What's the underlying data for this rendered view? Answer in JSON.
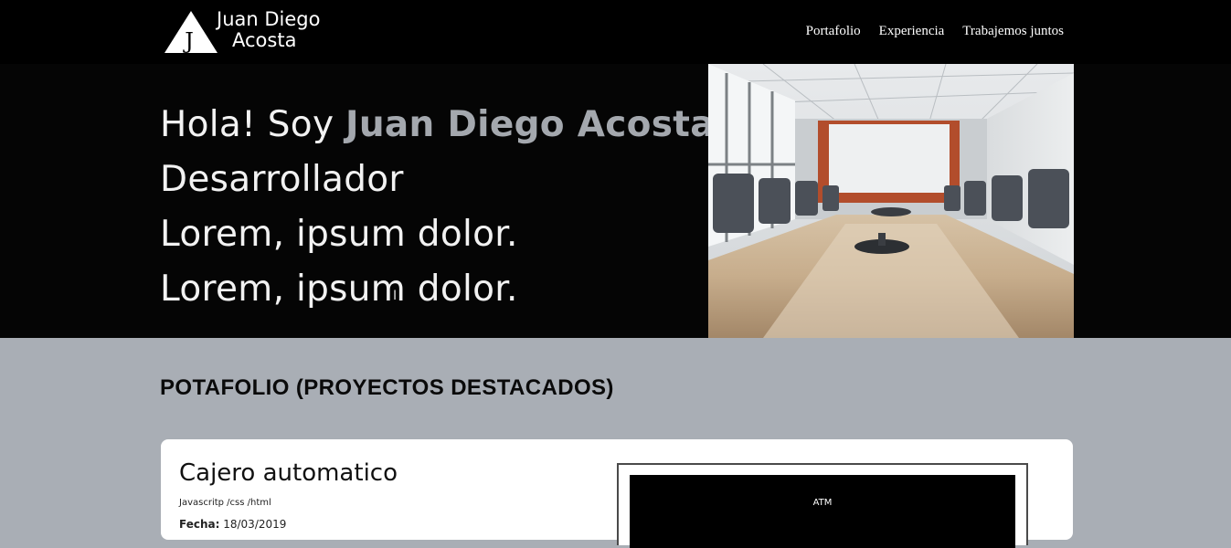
{
  "header": {
    "logo": {
      "mark": "J",
      "line1": "Juan Diego",
      "line2": "Acosta"
    },
    "nav": [
      {
        "label": "Portafolio"
      },
      {
        "label": "Experiencia"
      },
      {
        "label": "Trabajemos juntos"
      }
    ]
  },
  "hero": {
    "greeting": "Hola! Soy ",
    "name": "Juan Diego Acosta",
    "line2": "Desarrollador",
    "line3": "Lorem, ipsum dolor.",
    "line4": "Lorem, ipsum dolor.",
    "image_icon": "conference-room-photo"
  },
  "portfolio": {
    "title": "POTAFOLIO (PROYECTOS DESTACADOS)",
    "projects": [
      {
        "title": "Cajero automatico",
        "tech": "Javascritp /css /html",
        "date_label": "Fecha:",
        "date": "18/03/2019",
        "preview_text": "ATM"
      }
    ]
  },
  "colors": {
    "header_bg": "#000000",
    "hero_bg": "#050505",
    "accent_name": "#a4a8ae",
    "section_bg": "#a9aeb5",
    "card_bg": "#ffffff"
  }
}
